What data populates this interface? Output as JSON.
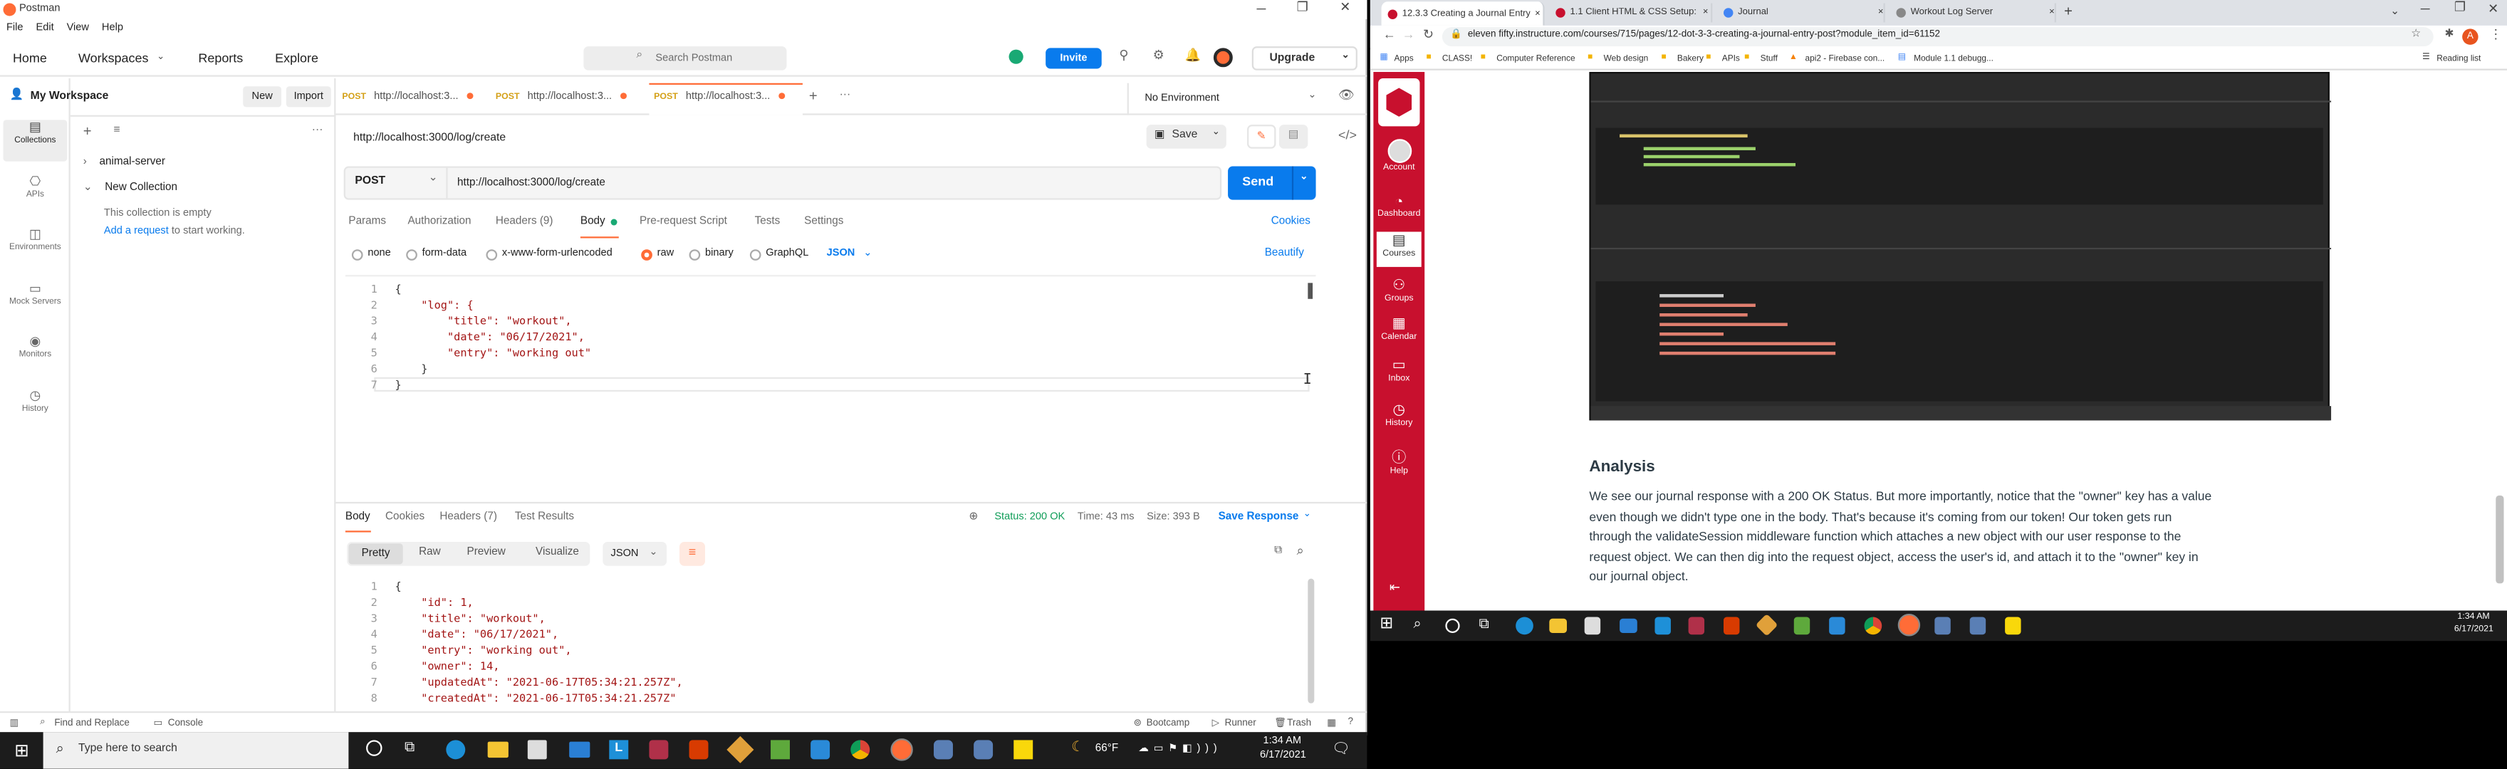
{
  "postman": {
    "title": "Postman",
    "menu": [
      "File",
      "Edit",
      "View",
      "Help"
    ],
    "nav": [
      "Home",
      "Workspaces",
      "Reports",
      "Explore"
    ],
    "search_placeholder": "Search Postman",
    "invite_label": "Invite",
    "upgrade_label": "Upgrade",
    "workspace_name": "My Workspace",
    "new_label": "New",
    "import_label": "Import",
    "sidebar_nav": [
      "Collections",
      "APIs",
      "Environments",
      "Mock Servers",
      "Monitors",
      "History"
    ],
    "collections": [
      {
        "name": "animal-server",
        "expanded": false
      },
      {
        "name": "New Collection",
        "expanded": true
      }
    ],
    "empty_text": "This collection is empty",
    "add_request_link": "Add a request",
    "add_request_suffix": " to start working.",
    "tabs": [
      {
        "method": "POST",
        "label": "http://localhost:3..."
      },
      {
        "method": "POST",
        "label": "http://localhost:3..."
      },
      {
        "method": "POST",
        "label": "http://localhost:3..."
      }
    ],
    "environment": "No Environment",
    "request_title": "http://localhost:3000/log/create",
    "save_label": "Save",
    "method": "POST",
    "url": "http://localhost:3000/log/create",
    "send_label": "Send",
    "req_tabs": [
      "Params",
      "Authorization",
      "Headers (9)",
      "Body",
      "Pre-request Script",
      "Tests",
      "Settings"
    ],
    "cookies_label": "Cookies",
    "body_types": [
      "none",
      "form-data",
      "x-www-form-urlencoded",
      "raw",
      "binary",
      "GraphQL"
    ],
    "body_format": "JSON",
    "beautify_label": "Beautify",
    "request_body": [
      "{",
      "    \"log\": {",
      "        \"title\": \"workout\",",
      "        \"date\": \"06/17/2021\",",
      "        \"entry\": \"working out\"",
      "    }",
      "}"
    ],
    "resp_tabs": [
      "Body",
      "Cookies",
      "Headers (7)",
      "Test Results"
    ],
    "status": "Status: 200 OK",
    "time": "Time: 43 ms",
    "size": "Size: 393 B",
    "save_response": "Save Response",
    "view_modes": [
      "Pretty",
      "Raw",
      "Preview",
      "Visualize"
    ],
    "resp_format": "JSON",
    "response_body": [
      "{",
      "    \"id\": 1,",
      "    \"title\": \"workout\",",
      "    \"date\": \"06/17/2021\",",
      "    \"entry\": \"working out\",",
      "    \"owner\": 14,",
      "    \"updatedAt\": \"2021-06-17T05:34:21.257Z\",",
      "    \"createdAt\": \"2021-06-17T05:34:21.257Z\""
    ],
    "footer": [
      "Find and Replace",
      "Console",
      "Bootcamp",
      "Runner",
      "Trash"
    ]
  },
  "browser": {
    "tabs": [
      "12.3.3 Creating a Journal Entry",
      "1.1 Client HTML & CSS Setup: W...",
      "Journal",
      "Workout Log Server"
    ],
    "address": "eleven fifty.instructure.com/courses/715/pages/12-dot-3-3-creating-a-journal-entry-post?module_item_id=61152",
    "bookmarks": [
      "Apps",
      "CLASS!",
      "Computer Reference",
      "Web design",
      "Bakery",
      "APIs",
      "Stuff",
      "api2 - Firebase con...",
      "Module 1.1 debugg..."
    ],
    "reading_list": "Reading list",
    "lms_nav": [
      "Account",
      "Dashboard",
      "Courses",
      "Groups",
      "Calendar",
      "Inbox",
      "History",
      "Help"
    ],
    "heading": "Analysis",
    "paragraph": "We see our journal response with a 200 OK Status. But more importantly, notice that the \"owner\" key has a value even though we didn't type one in the body. That's because it's coming from our token! Our token gets run through the validateSession middleware function which attaches a new object with our user response to the request object. We can then dig into the request object, access the user's id, and attach it to the \"owner\" key in our journal object.",
    "clock_time": "1:34 AM",
    "clock_date": "6/17/2021"
  },
  "taskbar": {
    "search_placeholder": "Type here to search",
    "weather": "66°F",
    "time": "1:34 AM",
    "date": "6/17/2021"
  },
  "colors": {
    "accent": "#ff6c37",
    "send": "#097bed",
    "lms_red": "#c8102e"
  }
}
